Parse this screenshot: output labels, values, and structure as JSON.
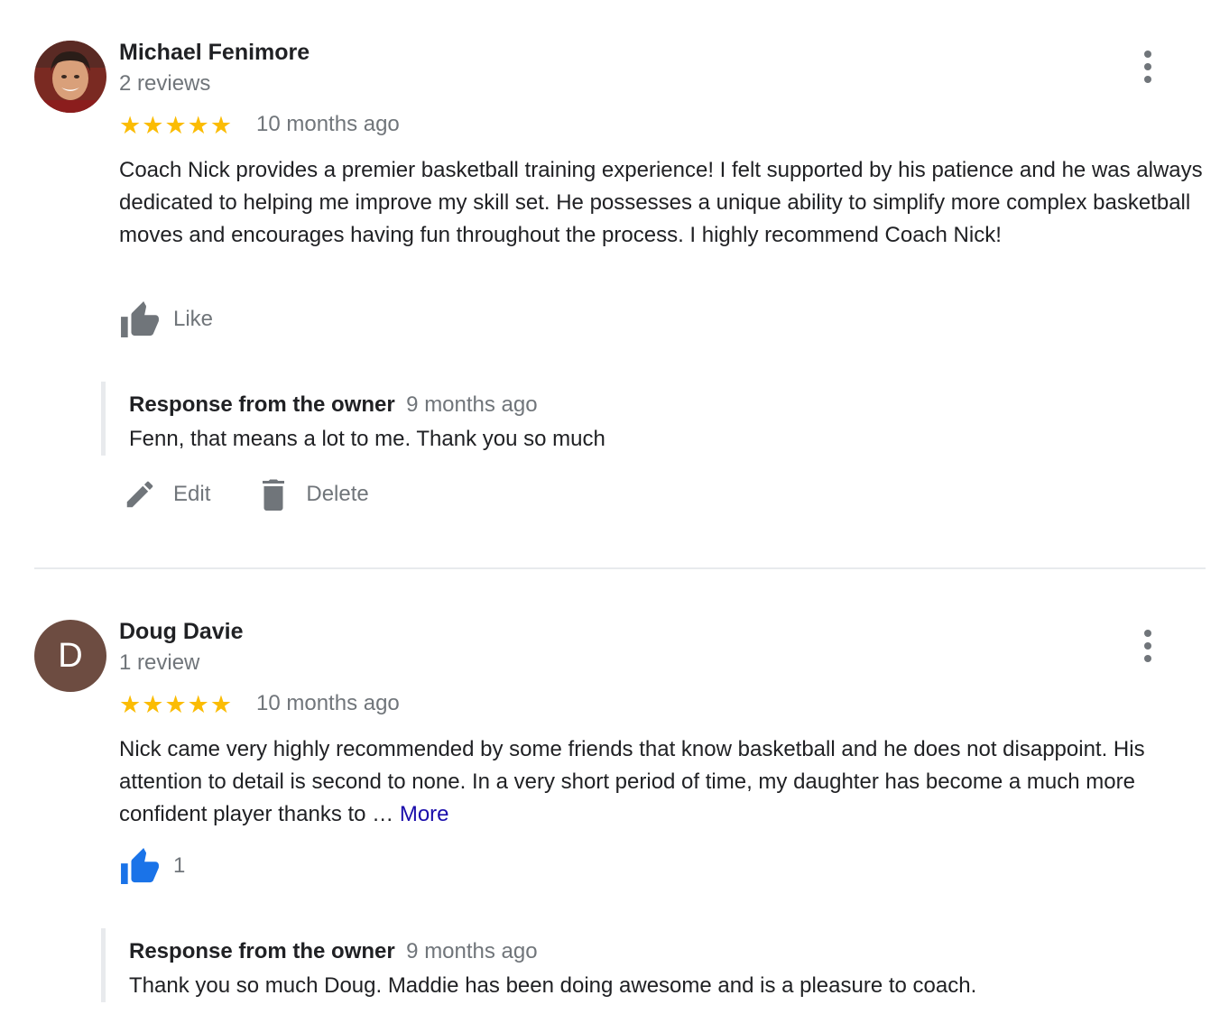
{
  "reviews": [
    {
      "name": "Michael Fenimore",
      "review_count": "2 reviews",
      "avatar_type": "photo",
      "rating": 5,
      "stars": [
        "★",
        "★",
        "★",
        "★",
        "★"
      ],
      "date": "10 months ago",
      "text": "Coach Nick provides a premier basketball training experience! I felt supported by his patience and he was always dedicated to helping me improve my skill set. He possesses a unique ability to simplify more complex basketball moves and encourages having fun throughout the process. I highly recommend Coach Nick!",
      "like_label": "Like",
      "like_color": "#70757a",
      "owner_response": {
        "title": "Response from the owner",
        "date": "9 months ago",
        "text": "Fenn, that means a lot to me. Thank you so much"
      },
      "actions": {
        "edit": "Edit",
        "delete": "Delete"
      }
    },
    {
      "name": "Doug Davie",
      "review_count": "1 review",
      "avatar_letter": "D",
      "avatar_color": "#6d4c41",
      "rating": 5,
      "stars": [
        "★",
        "★",
        "★",
        "★",
        "★"
      ],
      "date": "10 months ago",
      "text": "Nick came very highly recommended by some friends that know basketball and he does not disappoint. His attention to detail is second to none.  In a very short period of time, my daughter has become a much more confident player thanks to … ",
      "more_label": "More",
      "like_count": "1",
      "like_color": "#1a73e8",
      "owner_response": {
        "title": "Response from the owner",
        "date": "9 months ago",
        "text": "Thank you so much Doug. Maddie has been doing awesome and is a pleasure to coach."
      }
    }
  ],
  "icons": {
    "more": "more-vert-icon",
    "like": "thumb-up-icon",
    "edit": "pencil-icon",
    "delete": "trash-icon",
    "star": "star-icon"
  },
  "colors": {
    "star": "#fbbc04",
    "secondary_text": "#70757a",
    "link": "#1a0dab",
    "like_active": "#1a73e8"
  }
}
